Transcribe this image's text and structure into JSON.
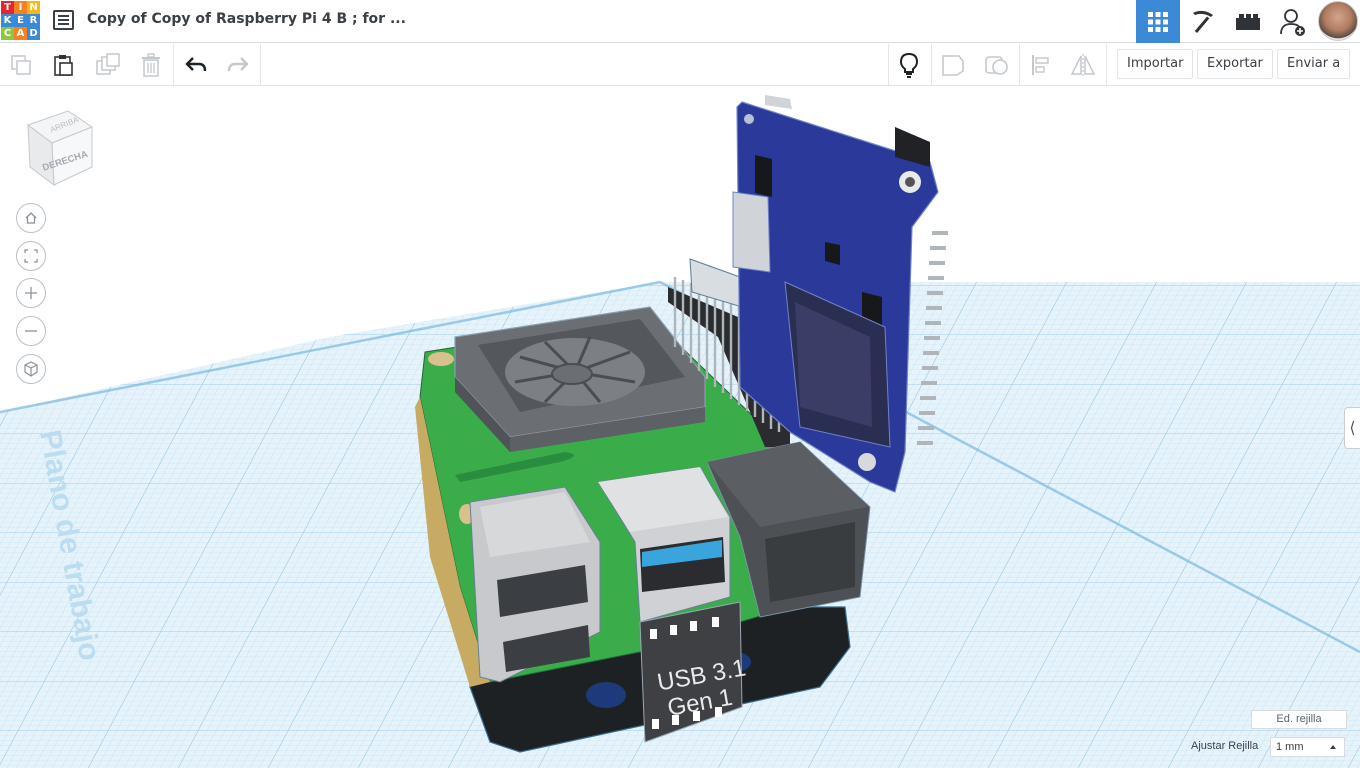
{
  "app": {
    "logo_letters": [
      "T",
      "I",
      "N",
      "K",
      "E",
      "R",
      "C",
      "A",
      "D"
    ],
    "logo_colors": [
      "#e4262f",
      "#f48220",
      "#f7b718",
      "#3c89d6",
      "#3c89d6",
      "#3c89d6",
      "#8dc63f",
      "#f48220",
      "#3c89d6"
    ],
    "document_title": "Copy of Copy of Raspberry Pi 4 B ; for ...",
    "accent_color": "#3c89d6"
  },
  "header": {
    "icons": [
      "menu-list-icon",
      "grid-view-icon",
      "pickaxe-icon",
      "bricks-icon",
      "add-user-icon",
      "avatar"
    ]
  },
  "toolbar": {
    "icons": [
      "copy-icon",
      "paste-icon",
      "duplicate-icon",
      "delete-icon",
      "undo-icon",
      "redo-icon",
      "lightbulb-icon",
      "note-icon",
      "shape-icon",
      "align-icon",
      "mirror-icon"
    ],
    "import_label": "Importar",
    "export_label": "Exportar",
    "send_label": "Enviar a"
  },
  "viewport": {
    "viewcube_label": "DERECHA",
    "viewcube_top_label": "ARRIBA",
    "workplane_label": "Plano de trabajo",
    "nav_icons": [
      "home-icon",
      "fit-view-icon",
      "zoom-in-icon",
      "zoom-out-icon",
      "perspective-icon"
    ],
    "usb_label_line1": "USB 3.1",
    "usb_label_line2": "Gen 1",
    "edit_grid_label": "Ed. rejilla",
    "snap_grid_label": "Ajustar Rejilla",
    "snap_grid_value": "1 mm"
  }
}
